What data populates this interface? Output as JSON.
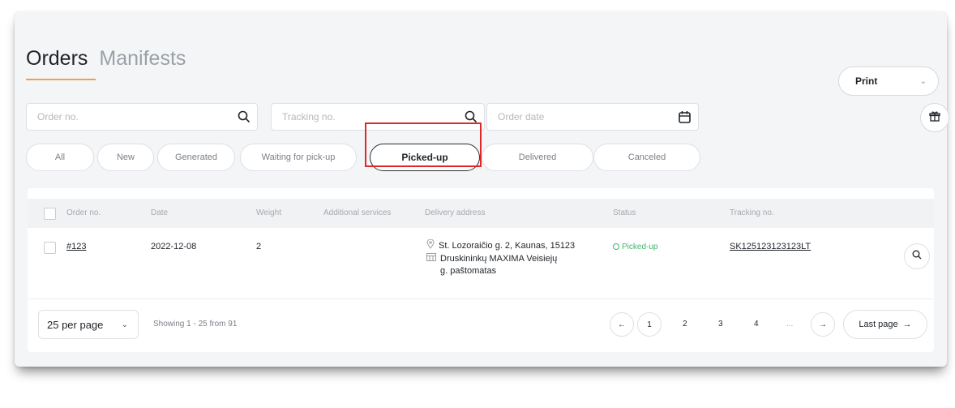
{
  "tabs": [
    {
      "label": "Orders",
      "active": true
    },
    {
      "label": "Manifests",
      "active": false
    }
  ],
  "print": {
    "label": "Print"
  },
  "filters": {
    "order_no_placeholder": "Order no.",
    "tracking_no_placeholder": "Tracking no.",
    "order_date_placeholder": "Order date"
  },
  "status_filters": [
    {
      "label": "All"
    },
    {
      "label": "New"
    },
    {
      "label": "Generated"
    },
    {
      "label": "Waiting for pick-up"
    },
    {
      "label": "Picked-up",
      "active": true
    },
    {
      "label": "Delivered"
    },
    {
      "label": "Canceled"
    }
  ],
  "table": {
    "headers": [
      "Order no.",
      "Date",
      "Weight",
      "Additional services",
      "Delivery address",
      "Status",
      "Tracking no."
    ],
    "rows": [
      {
        "order_no": "#123",
        "date": "2022-12-08",
        "weight": "2",
        "additional_services": "",
        "address_line1": "St. Lozoraičio g. 2, Kaunas, 15123",
        "address_line2": "Druskininkų MAXIMA Veisiejų",
        "address_line3": "g. paštomatas",
        "status": "Picked-up",
        "tracking_no": "SK125123123123LT"
      }
    ]
  },
  "pagination": {
    "per_page": "25 per page",
    "showing": "Showing 1 - 25 from 91",
    "prev": "←",
    "pages": [
      "1",
      "2",
      "3",
      "4"
    ],
    "ellipsis": "...",
    "next": "→",
    "last_page": "Last page"
  },
  "colors": {
    "accent_underline": "#e7a15a",
    "status_green": "#3fb56a",
    "highlight_red": "#e02828"
  }
}
